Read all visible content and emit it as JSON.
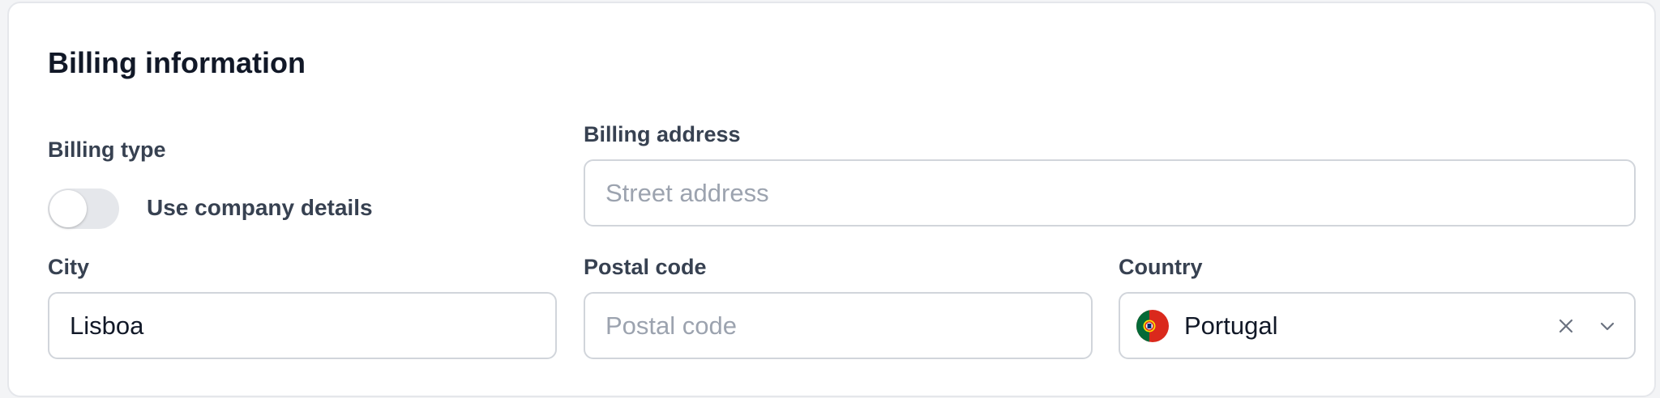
{
  "card": {
    "title": "Billing information"
  },
  "billing_type": {
    "label": "Billing type",
    "toggle_label": "Use company details",
    "toggle_on": false
  },
  "billing_address": {
    "label": "Billing address",
    "value": "",
    "placeholder": "Street address"
  },
  "city": {
    "label": "City",
    "value": "Lisboa",
    "placeholder": ""
  },
  "postal_code": {
    "label": "Postal code",
    "value": "",
    "placeholder": "Postal code"
  },
  "country": {
    "label": "Country",
    "selected": "Portugal",
    "flag_icon": "portugal-flag-icon",
    "clear_icon": "close-icon",
    "dropdown_icon": "chevron-down-icon"
  },
  "colors": {
    "text_primary": "#111827",
    "text_label": "#374151",
    "placeholder": "#9ca3af",
    "border": "#d1d5db",
    "card_border": "#e5e7eb",
    "toggle_off": "#e5e7eb",
    "flag_green": "#046a38",
    "flag_red": "#da291c",
    "flag_yellow": "#ffe100"
  }
}
